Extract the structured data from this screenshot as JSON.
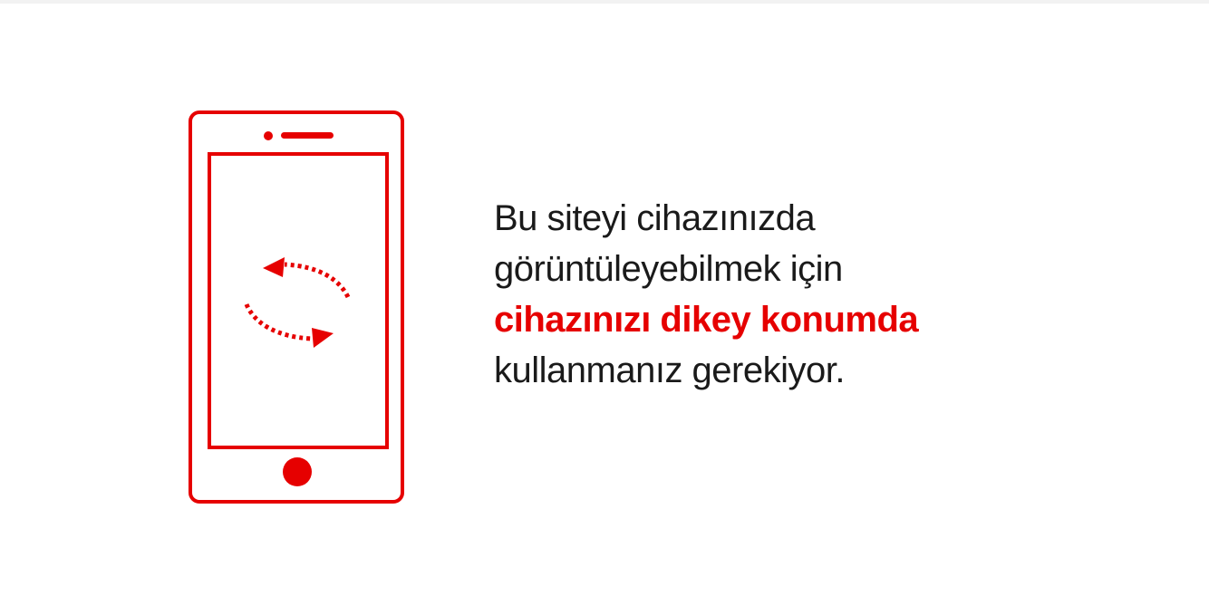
{
  "message": {
    "line1": "Bu siteyi cihazınızda",
    "line2": "görüntüleyebilmek için",
    "line3": "cihazınızı dikey konumda",
    "line4": "kullanmanız gerekiyor."
  },
  "colors": {
    "accent": "#e60000",
    "text": "#1a1a1a",
    "background": "#ffffff"
  },
  "icons": {
    "illustration": "rotate-phone-icon",
    "rotate_arrows": "rotate-arrows-icon"
  }
}
